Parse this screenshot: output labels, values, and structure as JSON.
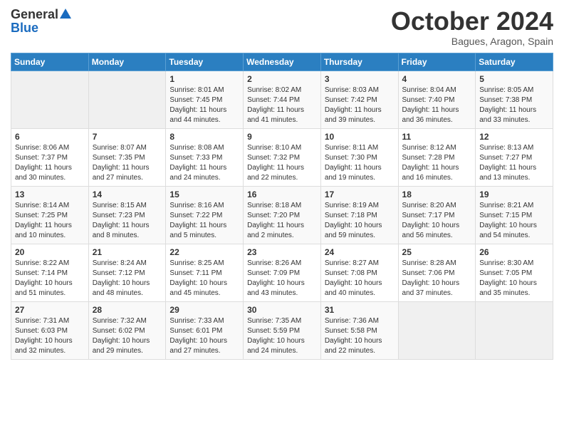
{
  "app": {
    "logo_general": "General",
    "logo_blue": "Blue"
  },
  "header": {
    "title": "October 2024",
    "subtitle": "Bagues, Aragon, Spain"
  },
  "calendar": {
    "days_of_week": [
      "Sunday",
      "Monday",
      "Tuesday",
      "Wednesday",
      "Thursday",
      "Friday",
      "Saturday"
    ],
    "weeks": [
      [
        {
          "day": "",
          "info": ""
        },
        {
          "day": "",
          "info": ""
        },
        {
          "day": "1",
          "info": "Sunrise: 8:01 AM\nSunset: 7:45 PM\nDaylight: 11 hours and 44 minutes."
        },
        {
          "day": "2",
          "info": "Sunrise: 8:02 AM\nSunset: 7:44 PM\nDaylight: 11 hours and 41 minutes."
        },
        {
          "day": "3",
          "info": "Sunrise: 8:03 AM\nSunset: 7:42 PM\nDaylight: 11 hours and 39 minutes."
        },
        {
          "day": "4",
          "info": "Sunrise: 8:04 AM\nSunset: 7:40 PM\nDaylight: 11 hours and 36 minutes."
        },
        {
          "day": "5",
          "info": "Sunrise: 8:05 AM\nSunset: 7:38 PM\nDaylight: 11 hours and 33 minutes."
        }
      ],
      [
        {
          "day": "6",
          "info": "Sunrise: 8:06 AM\nSunset: 7:37 PM\nDaylight: 11 hours and 30 minutes."
        },
        {
          "day": "7",
          "info": "Sunrise: 8:07 AM\nSunset: 7:35 PM\nDaylight: 11 hours and 27 minutes."
        },
        {
          "day": "8",
          "info": "Sunrise: 8:08 AM\nSunset: 7:33 PM\nDaylight: 11 hours and 24 minutes."
        },
        {
          "day": "9",
          "info": "Sunrise: 8:10 AM\nSunset: 7:32 PM\nDaylight: 11 hours and 22 minutes."
        },
        {
          "day": "10",
          "info": "Sunrise: 8:11 AM\nSunset: 7:30 PM\nDaylight: 11 hours and 19 minutes."
        },
        {
          "day": "11",
          "info": "Sunrise: 8:12 AM\nSunset: 7:28 PM\nDaylight: 11 hours and 16 minutes."
        },
        {
          "day": "12",
          "info": "Sunrise: 8:13 AM\nSunset: 7:27 PM\nDaylight: 11 hours and 13 minutes."
        }
      ],
      [
        {
          "day": "13",
          "info": "Sunrise: 8:14 AM\nSunset: 7:25 PM\nDaylight: 11 hours and 10 minutes."
        },
        {
          "day": "14",
          "info": "Sunrise: 8:15 AM\nSunset: 7:23 PM\nDaylight: 11 hours and 8 minutes."
        },
        {
          "day": "15",
          "info": "Sunrise: 8:16 AM\nSunset: 7:22 PM\nDaylight: 11 hours and 5 minutes."
        },
        {
          "day": "16",
          "info": "Sunrise: 8:18 AM\nSunset: 7:20 PM\nDaylight: 11 hours and 2 minutes."
        },
        {
          "day": "17",
          "info": "Sunrise: 8:19 AM\nSunset: 7:18 PM\nDaylight: 10 hours and 59 minutes."
        },
        {
          "day": "18",
          "info": "Sunrise: 8:20 AM\nSunset: 7:17 PM\nDaylight: 10 hours and 56 minutes."
        },
        {
          "day": "19",
          "info": "Sunrise: 8:21 AM\nSunset: 7:15 PM\nDaylight: 10 hours and 54 minutes."
        }
      ],
      [
        {
          "day": "20",
          "info": "Sunrise: 8:22 AM\nSunset: 7:14 PM\nDaylight: 10 hours and 51 minutes."
        },
        {
          "day": "21",
          "info": "Sunrise: 8:24 AM\nSunset: 7:12 PM\nDaylight: 10 hours and 48 minutes."
        },
        {
          "day": "22",
          "info": "Sunrise: 8:25 AM\nSunset: 7:11 PM\nDaylight: 10 hours and 45 minutes."
        },
        {
          "day": "23",
          "info": "Sunrise: 8:26 AM\nSunset: 7:09 PM\nDaylight: 10 hours and 43 minutes."
        },
        {
          "day": "24",
          "info": "Sunrise: 8:27 AM\nSunset: 7:08 PM\nDaylight: 10 hours and 40 minutes."
        },
        {
          "day": "25",
          "info": "Sunrise: 8:28 AM\nSunset: 7:06 PM\nDaylight: 10 hours and 37 minutes."
        },
        {
          "day": "26",
          "info": "Sunrise: 8:30 AM\nSunset: 7:05 PM\nDaylight: 10 hours and 35 minutes."
        }
      ],
      [
        {
          "day": "27",
          "info": "Sunrise: 7:31 AM\nSunset: 6:03 PM\nDaylight: 10 hours and 32 minutes."
        },
        {
          "day": "28",
          "info": "Sunrise: 7:32 AM\nSunset: 6:02 PM\nDaylight: 10 hours and 29 minutes."
        },
        {
          "day": "29",
          "info": "Sunrise: 7:33 AM\nSunset: 6:01 PM\nDaylight: 10 hours and 27 minutes."
        },
        {
          "day": "30",
          "info": "Sunrise: 7:35 AM\nSunset: 5:59 PM\nDaylight: 10 hours and 24 minutes."
        },
        {
          "day": "31",
          "info": "Sunrise: 7:36 AM\nSunset: 5:58 PM\nDaylight: 10 hours and 22 minutes."
        },
        {
          "day": "",
          "info": ""
        },
        {
          "day": "",
          "info": ""
        }
      ]
    ]
  }
}
